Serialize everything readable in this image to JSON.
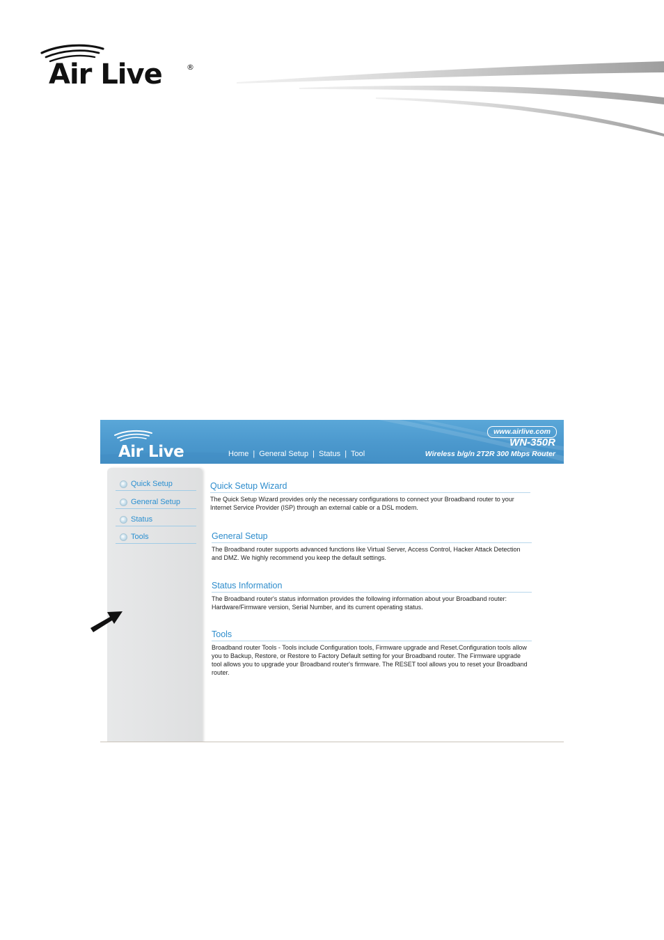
{
  "doc_header": {
    "logo_text": "Air Live",
    "logo_registered": "®"
  },
  "router_ui": {
    "banner": {
      "logo_text": "Air Live",
      "url": "www.airlive.com",
      "model": "WN-350R",
      "model_description": "Wireless b/g/n 2T2R 300 Mbps Router",
      "nav": [
        {
          "label": "Home"
        },
        {
          "label": "General Setup"
        },
        {
          "label": "Status"
        },
        {
          "label": "Tool"
        }
      ],
      "nav_separator": "|",
      "colors": {
        "banner_blue": "#4b98cd"
      }
    },
    "sidebar": {
      "items": [
        {
          "label": "Quick Setup",
          "icon": "bullet-icon"
        },
        {
          "label": "General Setup",
          "icon": "bullet-icon"
        },
        {
          "label": "Status",
          "icon": "bullet-icon"
        },
        {
          "label": "Tools",
          "icon": "bullet-icon"
        }
      ]
    },
    "sections": [
      {
        "title": "Quick Setup Wizard",
        "body": "The Quick Setup Wizard provides only the necessary configurations to connect your Broadband router to your Internet Service Provider (ISP) through an external cable or a DSL modem."
      },
      {
        "title": "General Setup",
        "body": "The Broadband router supports advanced functions like Virtual Server, Access Control, Hacker Attack Detection and DMZ. We highly recommend you keep the default settings."
      },
      {
        "title": "Status Information",
        "body": "The Broadband router's status information provides the following information about your Broadband router: Hardware/Firmware version, Serial Number, and its current operating status."
      },
      {
        "title": "Tools",
        "body": "Broadband router Tools - Tools include Configuration tools, Firmware upgrade and Reset.Configuration tools allow you to Backup, Restore, or Restore to Factory Default setting for your Broadband router. The Firmware upgrade tool allows you to upgrade your Broadband router's firmware. The RESET tool allows you to reset your Broadband router."
      }
    ]
  },
  "annotation": {
    "icon": "pointer-arrow-icon"
  }
}
